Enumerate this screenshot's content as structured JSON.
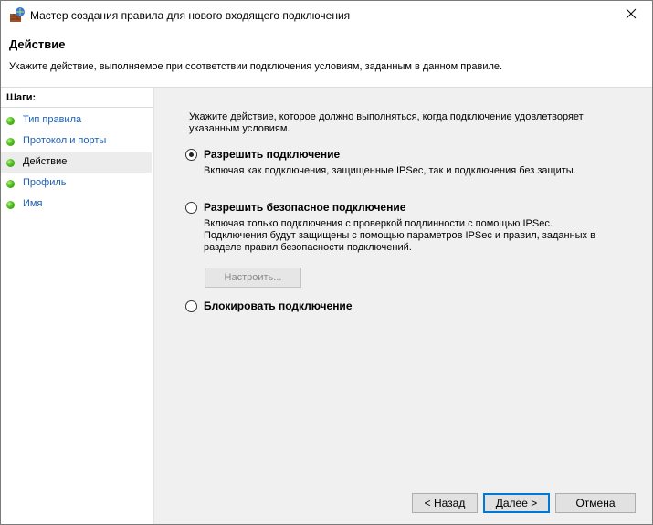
{
  "window": {
    "title": "Мастер создания правила для нового входящего подключения"
  },
  "header": {
    "title": "Действие",
    "description": "Укажите действие, выполняемое при соответствии подключения условиям, заданным в данном правиле."
  },
  "sidebar": {
    "steps_label": "Шаги:",
    "items": [
      {
        "label": "Тип правила"
      },
      {
        "label": "Протокол и порты"
      },
      {
        "label": "Действие"
      },
      {
        "label": "Профиль"
      },
      {
        "label": "Имя"
      }
    ]
  },
  "main": {
    "prompt": "Укажите действие, которое должно выполняться, когда подключение удовлетворяет указанным условиям.",
    "options": [
      {
        "label": "Разрешить подключение",
        "description": "Включая как подключения, защищенные IPSec, так и подключения без защиты.",
        "selected": true
      },
      {
        "label": "Разрешить безопасное подключение",
        "description": "Включая только подключения с проверкой подлинности с помощью IPSec. Подключения будут защищены с помощью параметров IPSec и правил, заданных в разделе правил безопасности подключений.",
        "selected": false
      },
      {
        "label": "Блокировать подключение",
        "description": "",
        "selected": false
      }
    ],
    "customize_button": "Настроить..."
  },
  "footer": {
    "back": "< Назад",
    "next": "Далее >",
    "cancel": "Отмена"
  },
  "colors": {
    "link": "#1a5fb4",
    "step_dot": "#4fbf1f",
    "primary_border": "#0078d7"
  }
}
